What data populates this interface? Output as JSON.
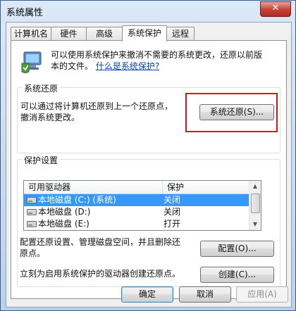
{
  "window": {
    "title": "系统属性",
    "close_glyph": "✕"
  },
  "tabs": [
    {
      "label": "计算机名",
      "active": false
    },
    {
      "label": "硬件",
      "active": false
    },
    {
      "label": "高级",
      "active": false
    },
    {
      "label": "系统保护",
      "active": true
    },
    {
      "label": "远程",
      "active": false
    }
  ],
  "intro": {
    "line1": "可以使用系统保护来撤消不需要的系统更改，还原以前版",
    "line2_prefix": "本的文件。",
    "link": "什么是系统保护?"
  },
  "restore": {
    "group_title": "系统还原",
    "desc_line1": "可以通过将计算机还原到上一个还原点，",
    "desc_line2": "撤消系统更改。",
    "button": "系统还原(S)..."
  },
  "protection": {
    "group_title": "保护设置",
    "columns": [
      "可用驱动器",
      "保护"
    ],
    "rows": [
      {
        "drive": "本地磁盘 (C:) (系统)",
        "protection": "关闭",
        "selected": true
      },
      {
        "drive": "本地磁盘 (D:)",
        "protection": "关闭",
        "selected": false
      },
      {
        "drive": "本地磁盘 (E:)",
        "protection": "打开",
        "selected": false
      }
    ],
    "configure_line1": "配置还原设置、管理磁盘空间，并且删除还",
    "configure_line2": "原点。",
    "configure_button": "配置(O)...",
    "create_text": "立刻为启用系统保护的驱动器创建还原点。",
    "create_button": "创建(C)..."
  },
  "footer": {
    "ok": "确定",
    "cancel": "取消",
    "apply": "应用(A)"
  },
  "colors": {
    "highlight": "#d9121f",
    "selection": "#3399ff",
    "link": "#0645ad"
  },
  "icons": [
    "close-icon",
    "system-protection-icon",
    "drive-icon",
    "scroll-up-icon",
    "scroll-down-icon"
  ]
}
